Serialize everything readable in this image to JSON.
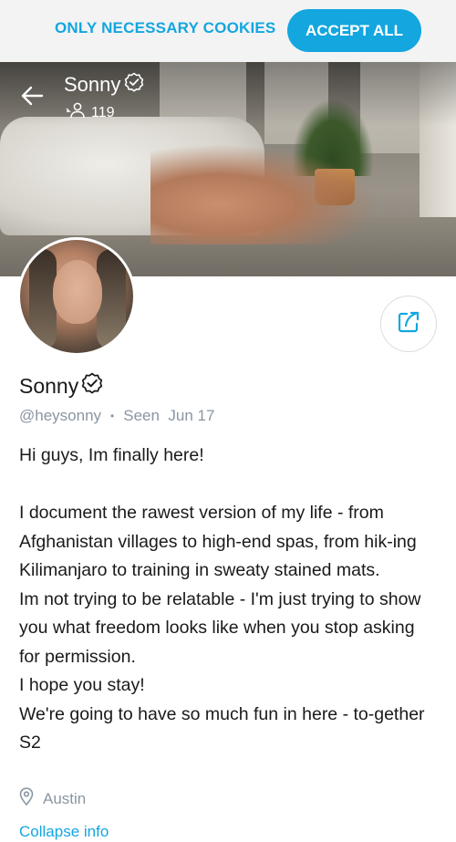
{
  "cookie_bar": {
    "necessary_label": "ONLY NECESSARY COOKIES",
    "accept_label": "ACCEPT ALL",
    "accent": "#13a6df"
  },
  "header": {
    "name": "Sonny",
    "followers": "119"
  },
  "profile": {
    "name": "Sonny",
    "handle": "@heysonny",
    "separator": "•",
    "seen": "Seen  Jun 17",
    "bio": "Hi guys, Im finally here!\n\nI document the rawest version of my life - from Afghanistan villages to high-end spas, from hik-ing Kilimanjaro to training in sweaty stained mats.\nIm not trying to be relatable - I'm just trying to show you what freedom looks like when you stop asking for permission.\nI hope you stay!\nWe're going to have so much fun in here - to-gether S2",
    "location": "Austin",
    "collapse_label": "Collapse info"
  },
  "icons": {
    "back": "back-arrow-icon",
    "verified": "verified-badge-icon",
    "followers": "followers-icon",
    "share": "share-icon",
    "location": "location-pin-icon"
  },
  "colors": {
    "accent": "#13a6df",
    "muted": "#8a96a3",
    "text": "#1a1a1a"
  }
}
